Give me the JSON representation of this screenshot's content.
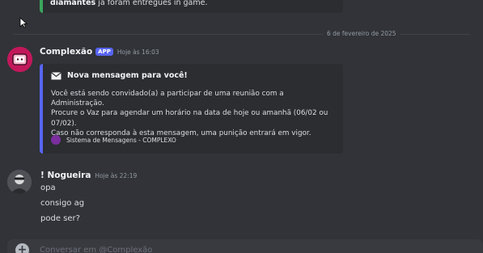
{
  "previous_embed": {
    "bold_text": "diamantes",
    "text": " já foram entregues in game."
  },
  "date_divider": "6 de fevereiro de 2025",
  "bot_message": {
    "author": "Complexão",
    "badge": "APP",
    "timestamp": "Hoje às 16:03",
    "embed": {
      "title": "Nova mensagem para você!",
      "description_lines": [
        "Você está sendo convidado(a) a participar de uma reunião com a Administração.",
        "Procure o Vaz para agendar um horário na data de hoje ou amanhã (06/02 ou 07/02).",
        "Caso não corresponda à esta mensagem, uma punição entrará em vigor."
      ],
      "footer": "Sistema de Mensagens - COMPLEXO"
    }
  },
  "user_message": {
    "author": "! Nogueira",
    "timestamp": "Hoje às 22:19",
    "lines": [
      "opa",
      "consigo ag",
      "pode ser?"
    ]
  },
  "composer": {
    "placeholder": "Conversar em @Complexão"
  },
  "icons": {
    "embed_title": "envelope-icon",
    "composer": "plus-icon",
    "cursor": "mouse-cursor-icon"
  },
  "colors": {
    "background": "#313338",
    "embed_background": "#2b2d31",
    "bot_embed_accent": "#5865f2",
    "previous_embed_accent": "#3ba55c",
    "app_badge": "#5865f2"
  }
}
